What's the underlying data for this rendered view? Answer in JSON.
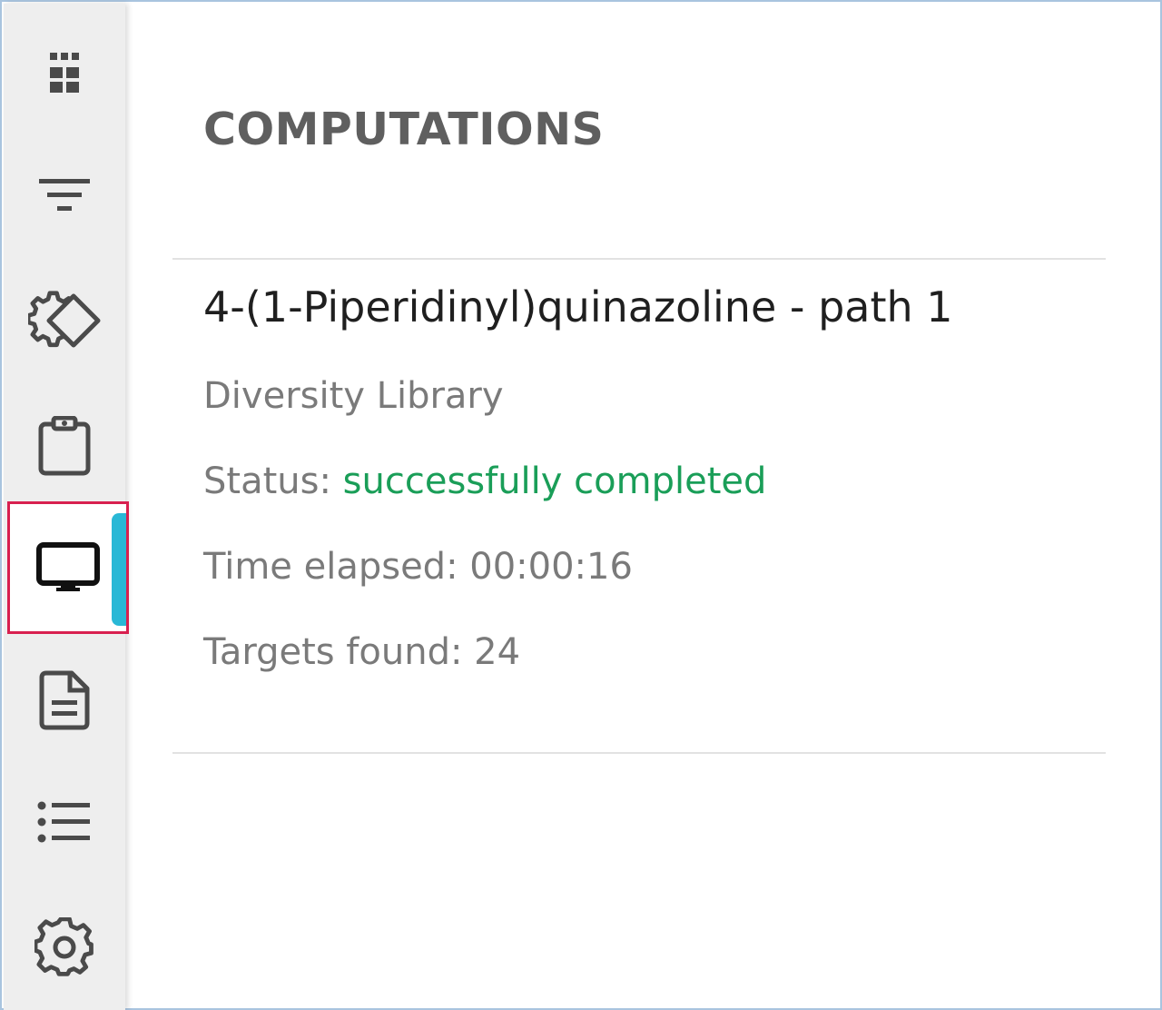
{
  "sidebar": {
    "items": [
      {
        "name": "dashboard",
        "icon": "grid-icon"
      },
      {
        "name": "filters",
        "icon": "filter-icon"
      },
      {
        "name": "configuration",
        "icon": "gear-diamond-icon"
      },
      {
        "name": "tasks",
        "icon": "clipboard-icon"
      },
      {
        "name": "computations",
        "icon": "monitor-icon",
        "active": true
      },
      {
        "name": "documents",
        "icon": "document-icon"
      },
      {
        "name": "list",
        "icon": "list-icon"
      },
      {
        "name": "settings",
        "icon": "gear-icon"
      }
    ],
    "active_color": "#29b8d6",
    "highlight_border_color": "#d8204f"
  },
  "main": {
    "title": "COMPUTATIONS",
    "computation": {
      "name": "4-(1-Piperidinyl)quinazoline - path 1",
      "library": "Diversity Library",
      "status_label": "Status:",
      "status_value": "successfully completed",
      "status_color": "#1a9e58",
      "time_elapsed": "Time elapsed: 00:00:16",
      "targets_found": "Targets found: 24"
    }
  }
}
